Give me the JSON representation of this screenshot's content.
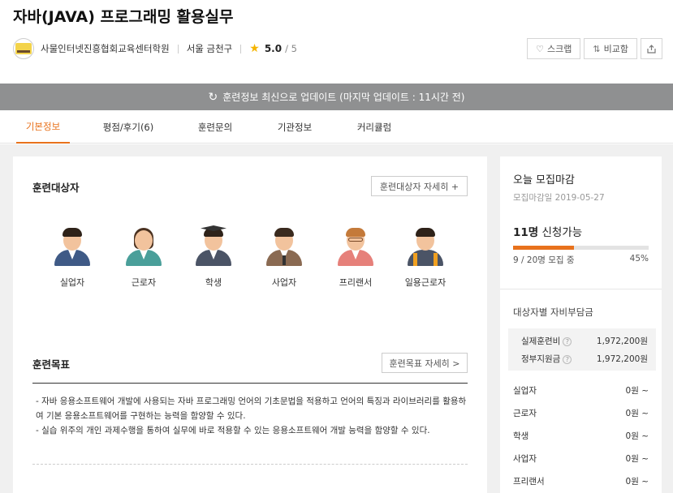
{
  "page": {
    "title": "자바(JAVA) 프로그래밍 활용실무"
  },
  "institution": {
    "name": "사물인터넷진흥협회교육센터학원",
    "location": "서울 금천구",
    "rating": "5.0",
    "rating_max": "/ 5"
  },
  "actions": {
    "scrap_label": "스크랩",
    "compare_label": "비교함",
    "scrap_icon": "heart-icon",
    "compare_icon": "swap-icon",
    "share_icon": "share-icon"
  },
  "update_bar": {
    "text": "훈련정보 최신으로 업데이트 (마지막 업데이트 : 11시간 전)",
    "icon": "refresh-icon"
  },
  "tabs": [
    {
      "label": "기본정보",
      "active": true
    },
    {
      "label": "평점/후기(6)",
      "active": false
    },
    {
      "label": "훈련문의",
      "active": false
    },
    {
      "label": "기관정보",
      "active": false
    },
    {
      "label": "커리큘럼",
      "active": false
    }
  ],
  "targets_section": {
    "title": "훈련대상자",
    "detail_label": "훈련대상자 자세히 +",
    "items": [
      {
        "label": "실업자"
      },
      {
        "label": "근로자"
      },
      {
        "label": "학생"
      },
      {
        "label": "사업자"
      },
      {
        "label": "프리랜서"
      },
      {
        "label": "일용근로자"
      }
    ]
  },
  "goal_section": {
    "title": "훈련목표",
    "detail_label": "훈련목표 자세히 >",
    "lines": [
      "- 자바 응용소프트웨어 개발에 사용되는 자바 프로그래밍 언어의 기초문법을 적용하고 언어의 특징과 라이브러리를 활용하여 기본 응용소프트웨어를 구현하는 능력을 함양할 수 있다.",
      "- 실습 위주의 개인 과제수행을 통하여 실무에 바로 적용할 수 있는 응용소프트웨어 개발 능력을 함양할 수 있다."
    ]
  },
  "sidebar": {
    "title": "오늘 모집마감",
    "deadline": "모집마감일 2019-05-27",
    "available_count": "11명",
    "available_suffix": " 신청가능",
    "enrolled_text": "9 / 20명 모집 중",
    "percent_text": "45%",
    "percent": 45,
    "accent_color": "#e8721c",
    "burden_title": "대상자별 자비부담금",
    "fees": [
      {
        "label": "실제훈련비",
        "value": "1,972,200원"
      },
      {
        "label": "정부지원금",
        "value": "1,972,200원"
      }
    ],
    "burden_rows": [
      {
        "label": "실업자",
        "value": "0원 ~"
      },
      {
        "label": "근로자",
        "value": "0원 ~"
      },
      {
        "label": "학생",
        "value": "0원 ~"
      },
      {
        "label": "사업자",
        "value": "0원 ~"
      },
      {
        "label": "프리랜서",
        "value": "0원 ~"
      }
    ]
  }
}
